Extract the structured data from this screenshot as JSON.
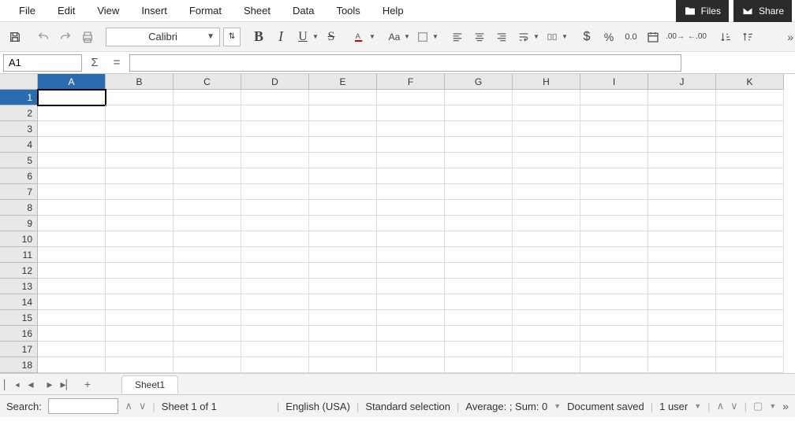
{
  "menu": {
    "items": [
      "File",
      "Edit",
      "View",
      "Insert",
      "Format",
      "Sheet",
      "Data",
      "Tools",
      "Help"
    ]
  },
  "top_buttons": {
    "files": "Files",
    "share": "Share"
  },
  "toolbar": {
    "font_name": "Calibri",
    "font_size_icon": "↑↓"
  },
  "formula_bar": {
    "cell_ref": "A1",
    "sigma": "Σ",
    "equals": "="
  },
  "grid": {
    "columns": [
      "A",
      "B",
      "C",
      "D",
      "E",
      "F",
      "G",
      "H",
      "I",
      "J",
      "K"
    ],
    "rows": [
      1,
      2,
      3,
      4,
      5,
      6,
      7,
      8,
      9,
      10,
      11,
      12,
      13,
      14,
      15,
      16,
      17,
      18
    ],
    "active_col": "A",
    "active_row": 1
  },
  "sheet_tabs": {
    "active": "Sheet1"
  },
  "statusbar": {
    "search_label": "Search:",
    "sheet_count": "Sheet 1 of 1",
    "language": "English (USA)",
    "selection": "Standard selection",
    "stats": "Average: ; Sum: 0",
    "save_status": "Document saved",
    "users": "1 user"
  }
}
